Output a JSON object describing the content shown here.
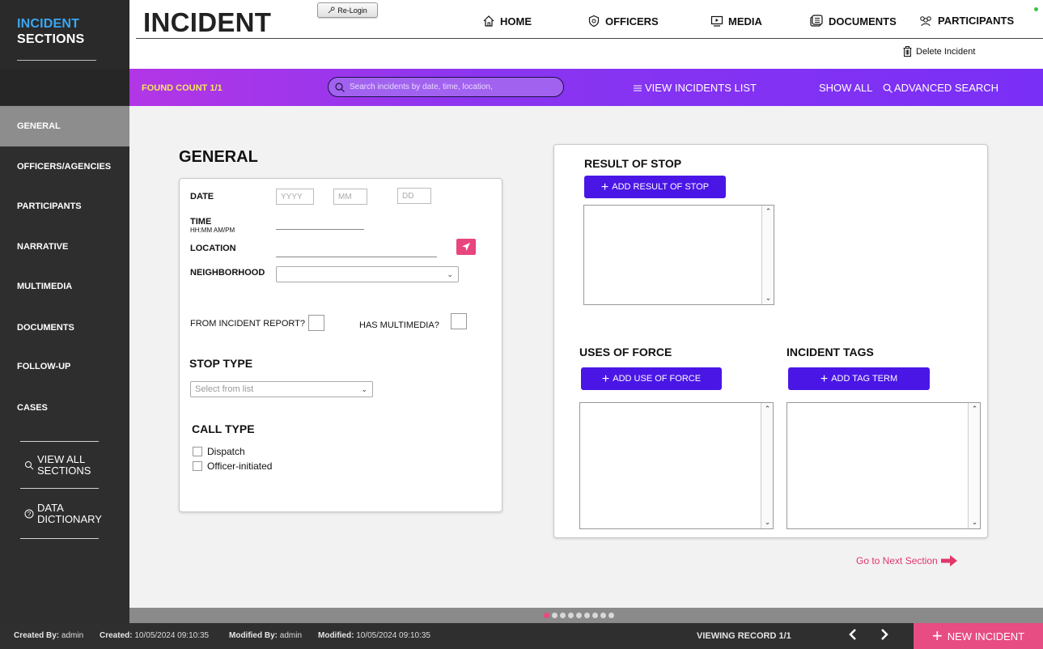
{
  "sidebar": {
    "title_line1": "INCIDENT",
    "title_line2": "SECTIONS",
    "items": [
      {
        "label": "GENERAL"
      },
      {
        "label": "OFFICERS/AGENCIES"
      },
      {
        "label": "PARTICIPANTS"
      },
      {
        "label": "NARRATIVE"
      },
      {
        "label": "MULTIMEDIA"
      },
      {
        "label": "DOCUMENTS"
      },
      {
        "label": "FOLLOW-UP"
      },
      {
        "label": "CASES"
      }
    ],
    "view_all_line1": "VIEW ALL",
    "view_all_line2": "SECTIONS",
    "data_dict_line1": "DATA",
    "data_dict_line2": "DICTIONARY"
  },
  "header": {
    "title": "INCIDENT",
    "relogin_label": "Re-Login",
    "nav": {
      "home": "HOME",
      "officers": "OFFICERS",
      "media": "MEDIA",
      "documents": "DOCUMENTS",
      "participants": "PARTICIPANTS"
    },
    "delete_label": "Delete Incident"
  },
  "toolbar": {
    "found_count": "FOUND COUNT 1/1",
    "search_placeholder": "Search incidents by date, time, location,",
    "view_list": "VIEW INCIDENTS LIST",
    "show_all": "SHOW ALL",
    "advanced_search": "ADVANCED SEARCH"
  },
  "general": {
    "heading": "GENERAL",
    "date_label": "DATE",
    "date_placeholders": {
      "year": "YYYY",
      "month": "MM",
      "day": "DD"
    },
    "time_label": "TIME",
    "time_format": "HH:MM AM/PM",
    "location_label": "LOCATION",
    "neighborhood_label": "NEIGHBORHOOD",
    "neighborhood_value": "",
    "from_report_label": "FROM INCIDENT REPORT?",
    "has_multimedia_label": "HAS MULTIMEDIA?",
    "stop_type_heading": "STOP TYPE",
    "stop_type_placeholder": "Select from list",
    "call_type_heading": "CALL TYPE",
    "call_type_options": [
      "Dispatch",
      "Officer-initiated"
    ]
  },
  "result_panel": {
    "result_heading": "RESULT OF STOP",
    "add_result": "ADD RESULT OF STOP",
    "uses_heading": "USES OF FORCE",
    "add_use": "ADD USE OF FORCE",
    "tags_heading": "INCIDENT TAGS",
    "add_tag": "ADD TAG TERM"
  },
  "next_section_label": "Go to Next Section",
  "pager": {
    "total_dots": 9,
    "active_index": 0
  },
  "footer": {
    "created_by_label": "Created By:",
    "created_by": "admin",
    "created_label": "Created:",
    "created": "10/05/2024 09:10:35",
    "modified_by_label": "Modified By:",
    "modified_by": "admin",
    "modified_label": "Modified:",
    "modified": "10/05/2024 09:10:35",
    "viewing_record": "VIEWING RECORD 1/1",
    "new_incident": "NEW INCIDENT"
  },
  "colors": {
    "sidebar_bg": "#2e2e2e",
    "sidebar_accent": "#3aa6f2",
    "toolbar_gradient_start": "#b236e6",
    "toolbar_gradient_end": "#7a2ff6",
    "found_count": "#f2e85a",
    "primary_button": "#4a16e6",
    "pink_accent": "#e74c82"
  }
}
